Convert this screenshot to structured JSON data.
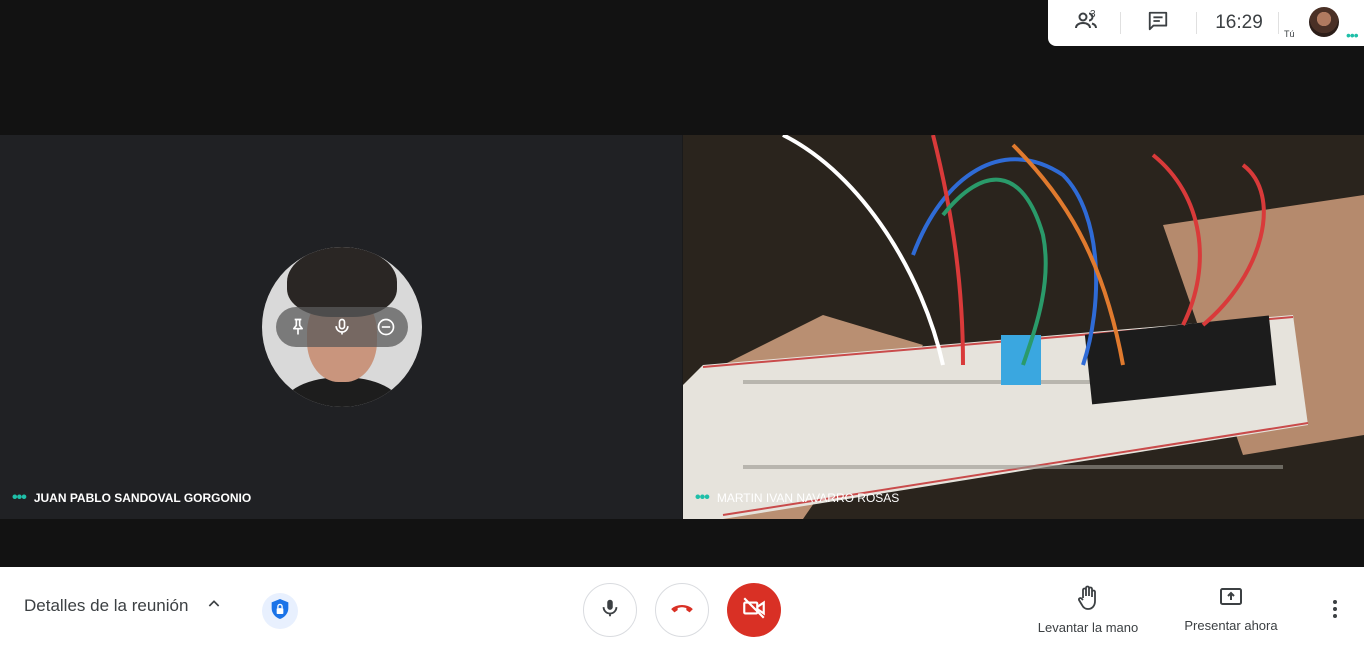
{
  "top_panel": {
    "participants_count": "3",
    "clock": "16:29",
    "self_label": "Tú",
    "icons": [
      "people-icon",
      "chat-icon"
    ]
  },
  "tiles": {
    "left": {
      "participant_name": "JUAN PABLO SANDOVAL GORGONIO",
      "speaking_indicator": "•••",
      "hover_icons": [
        "pin-icon",
        "microphone-icon",
        "remove-icon"
      ]
    },
    "right": {
      "participant_name": "MARTIN IVAN NAVARRO ROSAS",
      "speaking_indicator": "•••"
    }
  },
  "controls": {
    "meeting_details_label": "Detalles de la reunión",
    "raise_hand_label": "Levantar la mano",
    "present_label": "Presentar ahora"
  },
  "colors": {
    "accent_teal": "#1fbfa8",
    "danger_red": "#d93025",
    "shield_blue": "#1a73e8"
  }
}
